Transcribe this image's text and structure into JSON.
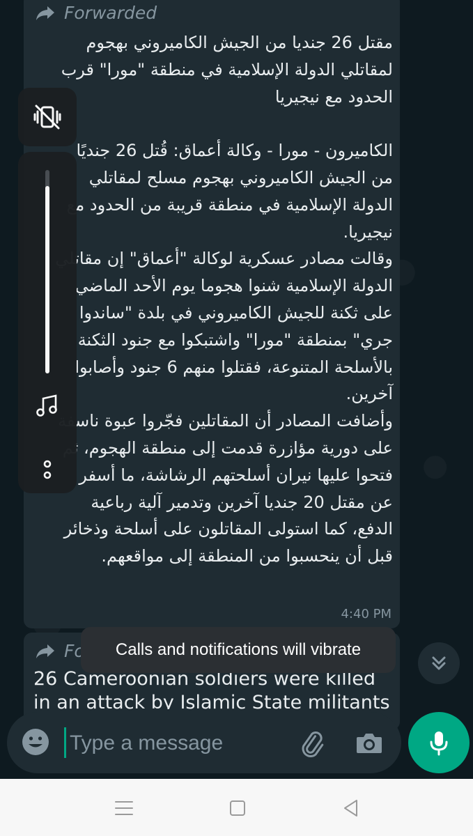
{
  "messages": [
    {
      "forwarded_label": "Forwarded",
      "text": "مقتل 26 جنديا من الجيش الكاميروني بهجوم\nلمقاتلي الدولة الإسلامية في منطقة \"مورا\" قرب\nالحدود مع نيجيريا\n\nالكاميرون - مورا - وكالة أعماق: قُتل 26 جنديًا\nمن الجيش الكاميروني بهجوم مسلح لمقاتلي\nالدولة الإسلامية في منطقة قريبة من الحدود مع\nنيجيريا.\nوقالت مصادر عسكرية لوكالة \"أعماق\" إن مقاتلي\nالدولة الإسلامية شنوا هجوما يوم الأحد الماضي\nعلى ثكنة للجيش الكاميروني في بلدة \"ساندوا\nجري\" بمنطقة \"مورا\" واشتبكوا مع جنود الثكنة\nبالأسلحة المتنوعة، فقتلوا منهم 6 جنود وأصابوا\nآخرين.\nوأضافت المصادر أن المقاتلين فجّروا عبوة ناسفة\nعلى دورية مؤازرة قدمت إلى منطقة الهجوم، ثم\nفتحوا عليها نيران أسلحتهم الرشاشة، ما أسفر\nعن مقتل 20 جنديا آخرين وتدمير آلية رباعية\nالدفع، كما استولى المقاتلون على أسلحة وذخائر\nقبل أن ينحسبوا من المنطقة إلى مواقعهم.",
      "time": "4:40 PM"
    },
    {
      "forwarded_label": "Fo",
      "text": "26 Cameroonian soldiers were killed\nin an attack by Islamic State militants"
    }
  ],
  "toast": "Calls and notifications will vibrate",
  "volume": {
    "level": 0.92,
    "ring_mode": "vibrate"
  },
  "input": {
    "placeholder": "Type a message",
    "value": ""
  },
  "icons": {
    "forward": "forward-arrow-icon",
    "emoji": "emoji-icon",
    "attach": "paperclip-icon",
    "camera": "camera-icon",
    "mic": "mic-icon",
    "scroll_down": "double-chevron-down-icon",
    "vibrate": "vibrate-mute-icon",
    "music": "music-note-icon",
    "more": "more-vertical-icon"
  },
  "colors": {
    "accent": "#00a884",
    "bubble": "#1f2c33",
    "background": "#0e1a20",
    "secondary_text": "#8696a0"
  }
}
